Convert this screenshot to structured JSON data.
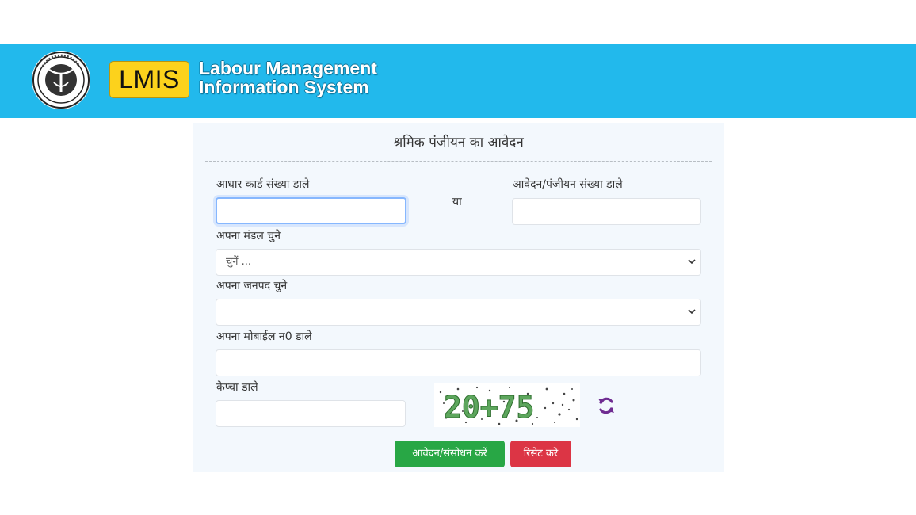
{
  "header": {
    "logo_abbr": "LMIS",
    "logo_line1": "Labour Management",
    "logo_line2": "Information System",
    "brand_color": "#22b9ec"
  },
  "form": {
    "title": "श्रमिक पंजीयन का आवेदन",
    "aadhaar_label": "आधार कार्ड संख्या डाले",
    "aadhaar_value": "",
    "or_text": "या",
    "application_label": "आवेदन/पंजीयन संख्या डाले",
    "application_value": "",
    "division_label": "अपना मंडल चुने",
    "division_selected": "चुनें ...",
    "district_label": "अपना जनपद चुने",
    "district_selected": "",
    "mobile_label": "अपना मोबाईल न0 डाले",
    "mobile_value": "",
    "captcha_label": "केप्चा डाले",
    "captcha_value": "",
    "captcha_text": "20+75",
    "submit_label": "आवेदन/संसोधन करें",
    "reset_label": "रिसेट करे",
    "submit_color": "#28a745",
    "reset_color": "#dc3545",
    "refresh_icon": "refresh-icon"
  }
}
